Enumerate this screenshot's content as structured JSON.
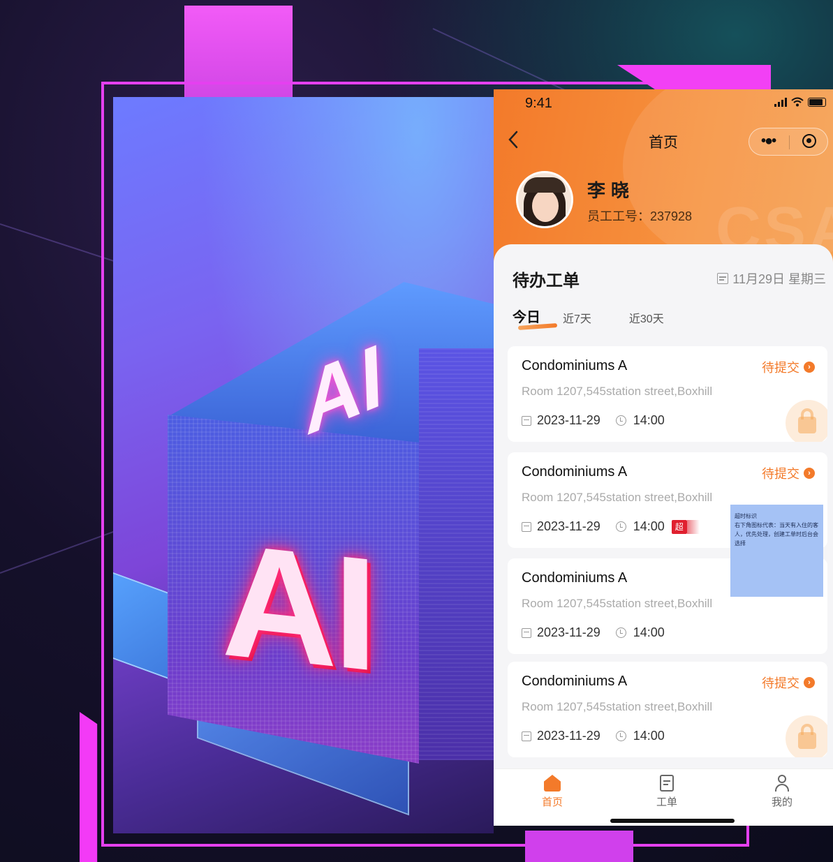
{
  "status_bar": {
    "time": "9:41"
  },
  "nav": {
    "back_icon": "chevron-left-icon",
    "title": "首页",
    "more_icon": "more-dots-icon",
    "close_icon": "target-icon"
  },
  "profile": {
    "name": "李晓",
    "employee_id_label": "员工工号：",
    "employee_id": "237928"
  },
  "watermark": "CSA",
  "tasks": {
    "title": "待办工单",
    "date": "11月29日 星期三",
    "tabs": [
      {
        "label": "今日",
        "active": true
      },
      {
        "label": "近7天",
        "active": false
      },
      {
        "label": "近30天",
        "active": false
      }
    ],
    "cards": [
      {
        "title": "Condominiums A",
        "status": "待提交",
        "address": "Room 1207,545station street,Boxhill",
        "date": "2023-11-29",
        "time": "14:00",
        "badge": "",
        "lock": true
      },
      {
        "title": "Condominiums A",
        "status": "待提交",
        "address": "Room 1207,545station street,Boxhill",
        "date": "2023-11-29",
        "time": "14:00",
        "badge": "超",
        "lock": false
      },
      {
        "title": "Condominiums A",
        "status": "",
        "address": "Room 1207,545station street,Boxhill",
        "date": "2023-11-29",
        "time": "14:00",
        "badge": "",
        "lock": false
      },
      {
        "title": "Condominiums A",
        "status": "待提交",
        "address": "Room 1207,545station street,Boxhill",
        "date": "2023-11-29",
        "time": "14:00",
        "badge": "",
        "lock": true
      }
    ]
  },
  "tooltip": {
    "title": "超时标识",
    "body": "右下角图标代表：当天有入住的客人，优先处理，创建工单时后台会选择"
  },
  "tabbar": [
    {
      "label": "首页",
      "icon": "home-icon",
      "active": true
    },
    {
      "label": "工单",
      "icon": "work-order-icon",
      "active": false
    },
    {
      "label": "我的",
      "icon": "user-icon",
      "active": false
    }
  ],
  "illustration": {
    "text_front": "AI",
    "text_top": "AI"
  },
  "colors": {
    "accent": "#f37a2a",
    "frame": "#e540f0",
    "overtime": "#e0202f",
    "tooltip_bg": "#a5c2f5"
  }
}
